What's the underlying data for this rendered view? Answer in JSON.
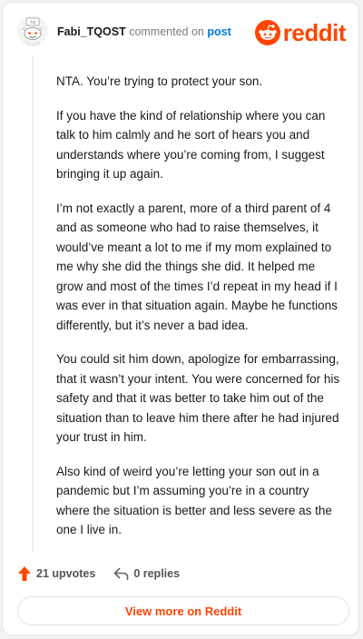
{
  "header": {
    "username": "Fabi_TQOST",
    "action_text": "commented on",
    "post_link": "post",
    "brand": "reddit",
    "avatar_icon": "snoo-avatar-icon",
    "brand_icon": "reddit-alien-icon"
  },
  "comment": {
    "paragraphs": [
      "NTA. You’re trying to protect your son.",
      "If you have the kind of relationship where you can talk to him calmly and he sort of hears you and understands where you’re coming from, I suggest bringing it up again.",
      "I’m not exactly a parent, more of a third parent of 4 and as someone who had to raise themselves, it would’ve meant a lot to me if my mom explained to me why she did the things she did. It helped me grow and most of the times I’d repeat in my head if I was ever in that situation again. Maybe he functions differently, but it’s never a bad idea.",
      "You could sit him down, apologize for embarrassing, that it wasn’t your intent. You were concerned for his safety and that it was better to take him out of the situation than to leave him there after he had injured your trust in him.",
      "Also kind of weird you’re letting your son out in a pandemic but I’m assuming you’re in a country where the situation is better and less severe as the one I live in."
    ]
  },
  "actions": {
    "upvotes_label": "21 upvotes",
    "replies_label": "0 replies",
    "upvote_icon": "upvote-arrow-icon",
    "reply_icon": "reply-arrow-icon"
  },
  "footer": {
    "view_more_label": "View more on Reddit"
  },
  "colors": {
    "brand": "#ff4500",
    "link": "#0079d3",
    "text": "#1a1a1b",
    "muted": "#7c7c7c"
  }
}
